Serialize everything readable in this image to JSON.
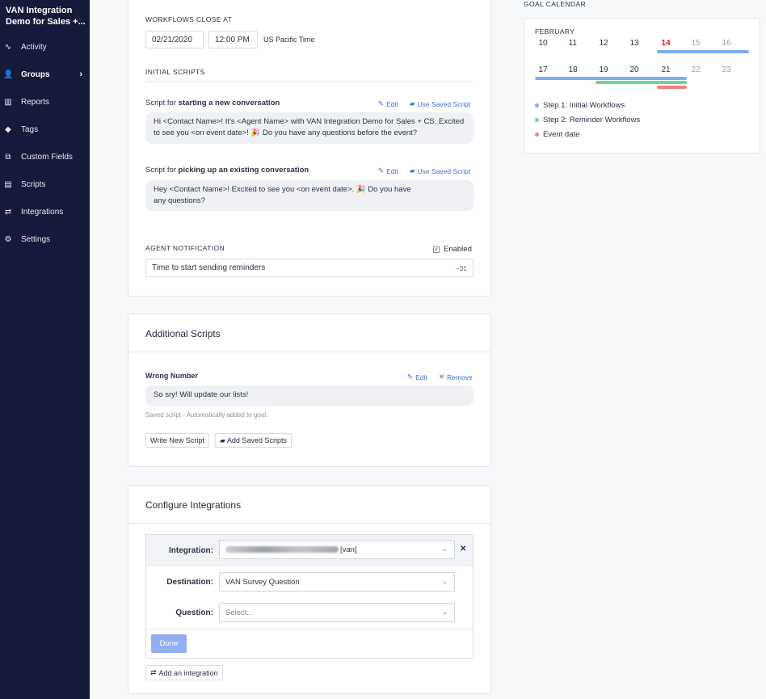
{
  "sidebar": {
    "title": "VAN Integration Demo for Sales +...",
    "items": [
      {
        "label": "Activity",
        "icon": "activity-icon",
        "glyph": "∿"
      },
      {
        "label": "Groups",
        "icon": "groups-icon",
        "glyph": "👤"
      },
      {
        "label": "Reports",
        "icon": "reports-icon",
        "glyph": "▥"
      },
      {
        "label": "Tags",
        "icon": "tag-icon",
        "glyph": "◆"
      },
      {
        "label": "Custom Fields",
        "icon": "custom-fields-icon",
        "glyph": "⧉"
      },
      {
        "label": "Scripts",
        "icon": "scripts-icon",
        "glyph": "▤"
      },
      {
        "label": "Integrations",
        "icon": "integrations-icon",
        "glyph": "⇄"
      },
      {
        "label": "Settings",
        "icon": "settings-icon",
        "glyph": "⚙"
      }
    ],
    "chevron": "›"
  },
  "workflow": {
    "close_label": "WORKFLOWS CLOSE AT",
    "date": "02/21/2020",
    "time": "12:00 PM",
    "timezone": "US Pacific Time",
    "initial_scripts_label": "INITIAL SCRIPTS",
    "script1": {
      "prefix": "Script for ",
      "strong": "starting a new conversation",
      "edit": "Edit",
      "use_saved": "Use Saved Script",
      "body": "Hi <Contact Name>! It's <Agent Name> with VAN Integration Demo for Sales + CS. Excited to see you <on event date>! 🎉 Do you have any questions before the event?"
    },
    "script2": {
      "prefix": "Script for ",
      "strong": "picking up an existing conversation",
      "edit": "Edit",
      "use_saved": "Use Saved Script",
      "body": "Hey <Contact Name>! Excited to see you <on event date>. 🎉 Do you have any questions?"
    },
    "agent_notification_label": "AGENT NOTIFICATION",
    "enabled_label": "Enabled",
    "notification_text": "Time to start sending reminders",
    "notification_offset": "−31"
  },
  "additional": {
    "title": "Additional Scripts",
    "script_name": "Wrong Number",
    "edit": "Edit",
    "remove": "Remove",
    "body": "So sry! Will update our lists!",
    "note": "Saved script - Automatically added to goal.",
    "write_new": "Write New Script",
    "add_saved": "Add Saved Scripts"
  },
  "integrations": {
    "title": "Configure Integrations",
    "integration_label": "Integration:",
    "integration_value": "[van]",
    "destination_label": "Destination:",
    "destination_value": "VAN Survey Question",
    "question_label": "Question:",
    "question_placeholder": "Select...",
    "done": "Done",
    "add": "Add an integration",
    "close": "✕"
  },
  "calendar": {
    "label": "GOAL CALENDAR",
    "month": "FEBRUARY",
    "week1": [
      "10",
      "11",
      "12",
      "13",
      "14",
      "15",
      "16"
    ],
    "week2": [
      "17",
      "18",
      "19",
      "20",
      "21",
      "22",
      "23"
    ],
    "legend": [
      {
        "label": "Step 1: Initial Workflows",
        "color": "#7faef0"
      },
      {
        "label": "Step 2: Reminder Workflows",
        "color": "#6fd39a"
      },
      {
        "label": "Event date",
        "color": "#f0837a"
      }
    ]
  }
}
